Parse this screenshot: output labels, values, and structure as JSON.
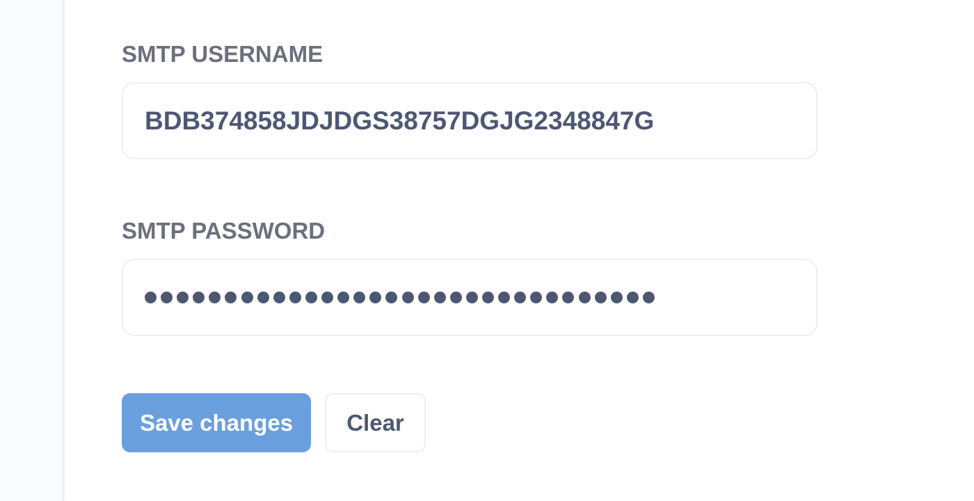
{
  "form": {
    "username": {
      "label": "SMTP USERNAME",
      "value": "BDB374858JDJDGS38757DGJG2348847G"
    },
    "password": {
      "label": "SMTP PASSWORD",
      "masked_length": 32,
      "mask_char": "●"
    }
  },
  "actions": {
    "save_label": "Save changes",
    "clear_label": "Clear"
  },
  "colors": {
    "primary": "#6a9fde",
    "text": "#4c5773",
    "label": "#6b6f7e",
    "border": "#eceef0",
    "sidebar_bg": "#f9fbfd"
  }
}
